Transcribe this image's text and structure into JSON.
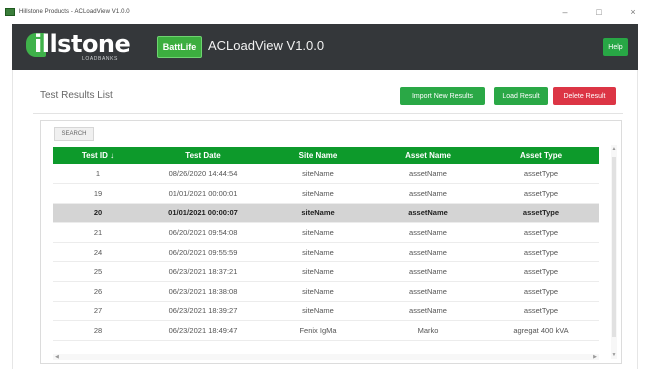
{
  "window": {
    "title": "Hillstone Products - ACLoadView V1.0.0",
    "controls": [
      "–",
      "□",
      "×"
    ]
  },
  "header": {
    "brand": "illstone",
    "brand_sub": "LOADBANKS",
    "battlife": "BattLife",
    "app_title": "ACLoadView V1.0.0",
    "help_label": "Help"
  },
  "panel": {
    "title": "Test Results List",
    "import_label": "Import New Results",
    "load_label": "Load Result",
    "delete_label": "Delete Result",
    "search_tab": "SEARCH"
  },
  "table": {
    "columns": [
      "Test ID ↓",
      "Test Date",
      "Site Name",
      "Asset Name",
      "Asset Type"
    ],
    "rows": [
      [
        "1",
        "08/26/2020 14:44:54",
        "siteName",
        "assetName",
        "assetType"
      ],
      [
        "19",
        "01/01/2021 00:00:01",
        "siteName",
        "assetName",
        "assetType"
      ],
      [
        "20",
        "01/01/2021 00:00:07",
        "siteName",
        "assetName",
        "assetType"
      ],
      [
        "21",
        "06/20/2021 09:54:08",
        "siteName",
        "assetName",
        "assetType"
      ],
      [
        "24",
        "06/20/2021 09:55:59",
        "siteName",
        "assetName",
        "assetType"
      ],
      [
        "25",
        "06/23/2021 18:37:21",
        "siteName",
        "assetName",
        "assetType"
      ],
      [
        "26",
        "06/23/2021 18:38:08",
        "siteName",
        "assetName",
        "assetType"
      ],
      [
        "27",
        "06/23/2021 18:39:27",
        "siteName",
        "assetName",
        "assetType"
      ],
      [
        "28",
        "06/23/2021 18:49:47",
        "Fenix IgMa",
        "Marko",
        "agregat 400 kVA"
      ]
    ],
    "selected_row": 2
  },
  "colors": {
    "header_bg": "#34373a",
    "accent_green": "#0d9a2b",
    "button_green": "#2aa846",
    "danger_red": "#dc3545",
    "selected_row": "#d4d4d4"
  },
  "icons": [
    "app-icon",
    "minimize-icon",
    "maximize-icon",
    "close-icon"
  ]
}
